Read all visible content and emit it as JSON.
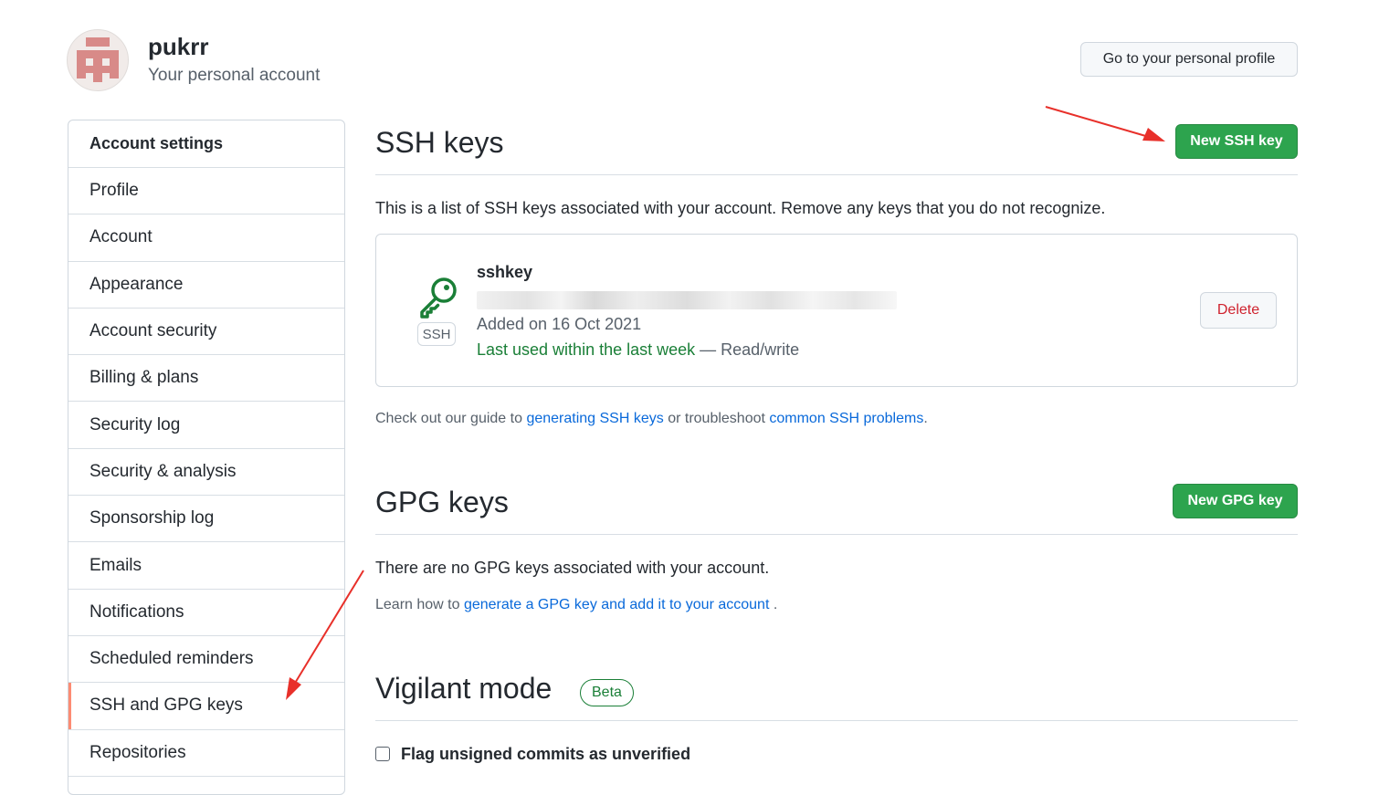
{
  "header": {
    "username": "pukrr",
    "subtitle": "Your personal account",
    "profile_button": "Go to your personal profile"
  },
  "sidebar": {
    "title": "Account settings",
    "items": [
      {
        "label": "Profile",
        "active": false
      },
      {
        "label": "Account",
        "active": false
      },
      {
        "label": "Appearance",
        "active": false
      },
      {
        "label": "Account security",
        "active": false
      },
      {
        "label": "Billing & plans",
        "active": false
      },
      {
        "label": "Security log",
        "active": false
      },
      {
        "label": "Security & analysis",
        "active": false
      },
      {
        "label": "Sponsorship log",
        "active": false
      },
      {
        "label": "Emails",
        "active": false
      },
      {
        "label": "Notifications",
        "active": false
      },
      {
        "label": "Scheduled reminders",
        "active": false
      },
      {
        "label": "SSH and GPG keys",
        "active": true
      },
      {
        "label": "Repositories",
        "active": false
      }
    ]
  },
  "ssh": {
    "title": "SSH keys",
    "new_button": "New SSH key",
    "description": "This is a list of SSH keys associated with your account. Remove any keys that you do not recognize.",
    "keys": [
      {
        "type_label": "SSH",
        "title": "sshkey",
        "added": "Added on 16 Oct 2021",
        "last_used": "Last used within the last week",
        "access": " — Read/write",
        "delete_label": "Delete"
      }
    ],
    "guide": {
      "prefix": "Check out our guide to ",
      "link1": "generating SSH keys",
      "middle": " or troubleshoot ",
      "link2": "common SSH problems",
      "suffix": "."
    }
  },
  "gpg": {
    "title": "GPG keys",
    "new_button": "New GPG key",
    "empty_text": "There are no GPG keys associated with your account.",
    "learn": {
      "prefix": "Learn how to ",
      "link": "generate a GPG key and add it to your account",
      "suffix": " ."
    }
  },
  "vigilant": {
    "title": "Vigilant mode",
    "badge": "Beta",
    "checkbox_label": "Flag unsigned commits as unverified"
  },
  "colors": {
    "primary_green": "#2da44e",
    "link_blue": "#0969da",
    "danger_red": "#cf222e",
    "active_accent": "#fd8c73",
    "annotation_red": "#e8302a"
  },
  "icons": {
    "key": "key-icon",
    "avatar": "identicon-avatar"
  }
}
